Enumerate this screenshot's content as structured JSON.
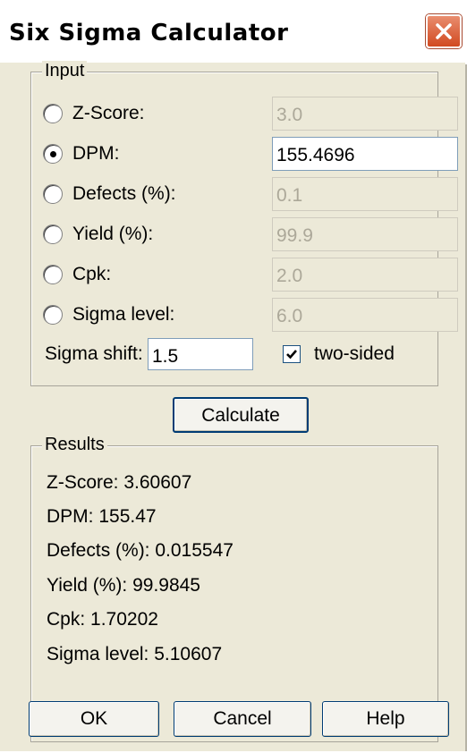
{
  "window": {
    "title": "Six Sigma Calculator"
  },
  "input": {
    "legend": "Input",
    "options": [
      {
        "label": "Z-Score:",
        "value": "3.0",
        "selected": false
      },
      {
        "label": "DPM:",
        "value": "155.4696",
        "selected": true
      },
      {
        "label": "Defects (%):",
        "value": "0.1",
        "selected": false
      },
      {
        "label": "Yield (%):",
        "value": "99.9",
        "selected": false
      },
      {
        "label": "Cpk:",
        "value": "2.0",
        "selected": false
      },
      {
        "label": "Sigma level:",
        "value": "6.0",
        "selected": false
      }
    ],
    "sigma_shift_label": "Sigma shift:",
    "sigma_shift_value": "1.5",
    "two_sided_label": "two-sided",
    "two_sided_checked": true
  },
  "calculate_label": "Calculate",
  "results": {
    "legend": "Results",
    "lines": [
      "Z-Score: 3.60607",
      "DPM: 155.47",
      "Defects (%): 0.015547",
      "Yield (%): 99.9845",
      "Cpk: 1.70202",
      "Sigma level: 5.10607"
    ]
  },
  "buttons": {
    "ok": "OK",
    "cancel": "Cancel",
    "help": "Help"
  }
}
